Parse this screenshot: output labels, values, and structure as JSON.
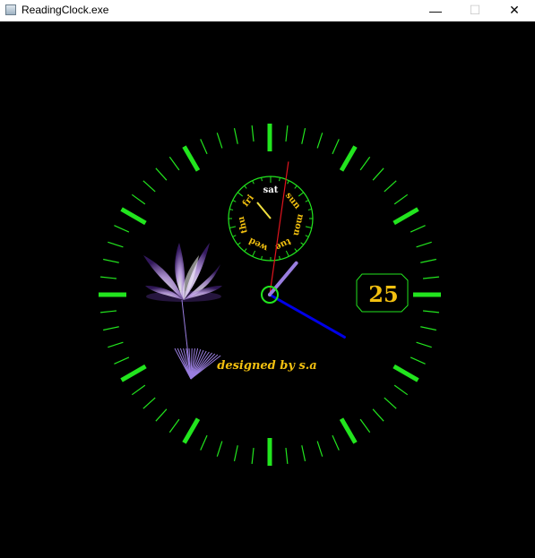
{
  "window": {
    "title": "ReadingClock.exe",
    "icon": "app-window-icon",
    "minimize_glyph": "—",
    "maximize_glyph": "☐",
    "close_glyph": "✕"
  },
  "clock": {
    "colors": {
      "ticks": "#22e51e",
      "hour_hand": "#9a7ee0",
      "minute_hand": "#0000e8",
      "second_hand": "#e0141e",
      "center_ring": "#22e51e",
      "text": "#f2c010",
      "day_hand": "#f0e040"
    },
    "date_value": "25",
    "day_labels": [
      "sun",
      "mon",
      "tue",
      "wed",
      "thu",
      "fri",
      "sat"
    ],
    "current_day": "sat",
    "credit": "designed by s.a",
    "flower_decoration": "lotus-flower-graphic",
    "time": {
      "hour": 1,
      "minute": 20,
      "second": 1
    }
  }
}
